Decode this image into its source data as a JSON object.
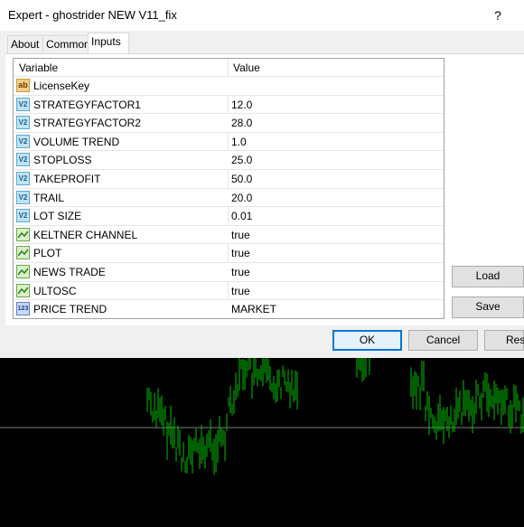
{
  "window": {
    "title": "Expert - ghostrider NEW V11_fix",
    "help": "?"
  },
  "tabs": [
    {
      "label": "About"
    },
    {
      "label": "Common"
    },
    {
      "label": "Inputs"
    }
  ],
  "grid": {
    "headers": {
      "variable": "Variable",
      "value": "Value"
    },
    "rows": [
      {
        "name": "LicenseKey",
        "value": "",
        "icon": "ab"
      },
      {
        "name": "STRATEGYFACTOR1",
        "value": "12.0",
        "icon": "v2"
      },
      {
        "name": "STRATEGYFACTOR2",
        "value": "28.0",
        "icon": "v2"
      },
      {
        "name": "VOLUME TREND",
        "value": "1.0",
        "icon": "v2"
      },
      {
        "name": "STOPLOSS",
        "value": "25.0",
        "icon": "v2"
      },
      {
        "name": "TAKEPROFIT",
        "value": "50.0",
        "icon": "v2"
      },
      {
        "name": "TRAIL",
        "value": "20.0",
        "icon": "v2"
      },
      {
        "name": "LOT SIZE",
        "value": "0.01",
        "icon": "v2"
      },
      {
        "name": "KELTNER CHANNEL",
        "value": "true",
        "icon": "bool"
      },
      {
        "name": "PLOT",
        "value": "true",
        "icon": "bool"
      },
      {
        "name": "NEWS TRADE",
        "value": "true",
        "icon": "bool"
      },
      {
        "name": "ULTOSC",
        "value": "true",
        "icon": "bool"
      },
      {
        "name": "PRICE TREND",
        "value": "MARKET",
        "icon": "123"
      }
    ]
  },
  "buttons": {
    "load": "Load",
    "save": "Save",
    "ok": "OK",
    "cancel": "Cancel",
    "reset": "Res"
  },
  "icons": {
    "ab": "ab",
    "v2": "V2",
    "123": "123"
  },
  "colors": {
    "candles": "#00c000",
    "grid_line": "#7f7f7f"
  }
}
